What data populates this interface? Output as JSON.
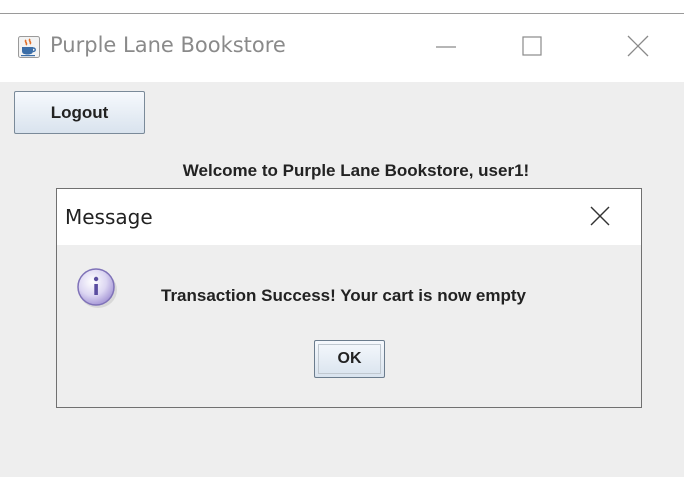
{
  "window": {
    "title": "Purple Lane Bookstore",
    "icon": "java-coffee-cup-icon"
  },
  "window_controls": {
    "minimize_icon": "minimize-icon",
    "maximize_icon": "maximize-icon",
    "close_icon": "close-icon"
  },
  "main": {
    "logout_label": "Logout",
    "welcome_text": "Welcome to Purple Lane Bookstore, user1!"
  },
  "dialog": {
    "title": "Message",
    "close_icon": "close-icon",
    "icon": "info-icon",
    "message": "Transaction Success! Your cart is now empty",
    "ok_label": "OK"
  }
}
